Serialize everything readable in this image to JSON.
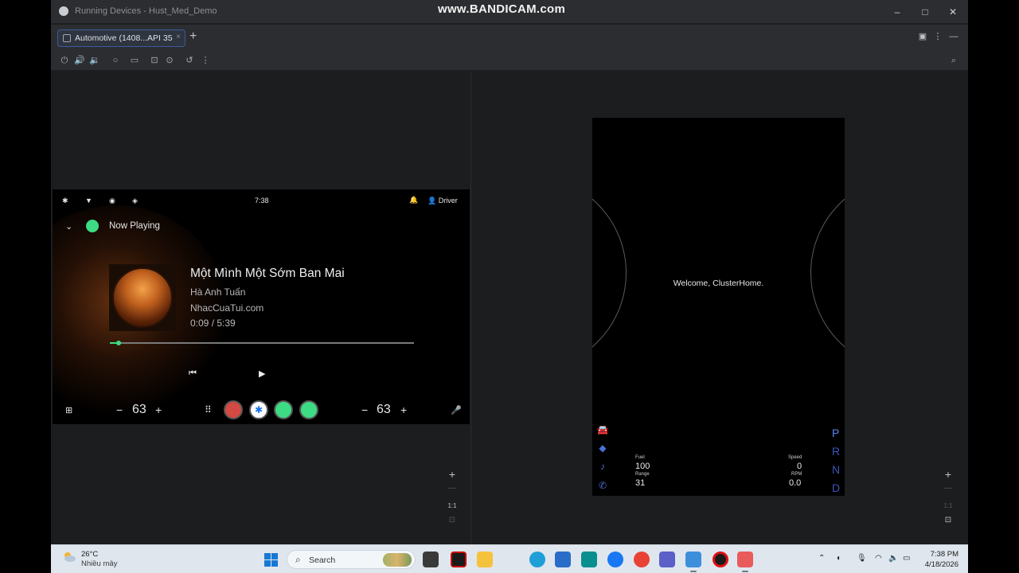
{
  "window": {
    "title": "Running Devices - Hust_Med_Demo",
    "watermark": "www.BANDICAM.com",
    "controls": {
      "minimize": "–",
      "maximize": "□",
      "close": "✕"
    }
  },
  "tabs": [
    {
      "label": "Automotive (1408...API 35",
      "close": "×"
    }
  ],
  "tabbar": {
    "add": "+"
  },
  "toolbar_icons": [
    "power-icon",
    "volume-up-icon",
    "volume-down-icon",
    "home-icon",
    "overview-icon",
    "screenshot-icon",
    "screen-record-icon",
    "rotate-icon",
    "more-icon"
  ],
  "infotainment": {
    "status_bar": {
      "time": "7:38",
      "user": "Driver"
    },
    "now_playing": {
      "title": "Now Playing",
      "song": "Một Mình Một Sớm Ban Mai",
      "artist": "Hà Anh Tuấn",
      "source": "NhacCuaTui.com",
      "time": "0:09 / 5:39",
      "progress": 0.03
    },
    "controls": {
      "prev": "⏮",
      "play": "▶"
    },
    "dock": {
      "left_temp": "63",
      "right_temp": "63",
      "minus": "−",
      "plus": "+"
    }
  },
  "zoom_controls": {
    "plus": "+",
    "minus": "—",
    "one_to_one": "1:1"
  },
  "cluster": {
    "welcome": "Welcome, ClusterHome.",
    "fuel_label": "Fuel",
    "fuel_value": "100",
    "range_label": "Range",
    "range_value": "31",
    "speed_label": "Speed",
    "speed_value": "0",
    "rpm_label": "RPM",
    "rpm_value": "0.0",
    "gears": [
      "P",
      "R",
      "N",
      "D"
    ],
    "active_gear": "P"
  },
  "taskbar": {
    "temperature": "26°C",
    "condition": "Nhiều mây",
    "search_label": "Search",
    "time": "7:38 PM",
    "date": "4/18/2026",
    "colors": {
      "background": "#dfe6ee",
      "accent": "#1777d4"
    }
  },
  "colors": {
    "android_green": "#3ddc84",
    "cluster_blue": "#4a6fd6",
    "ide_bg": "#1b1d1f"
  }
}
